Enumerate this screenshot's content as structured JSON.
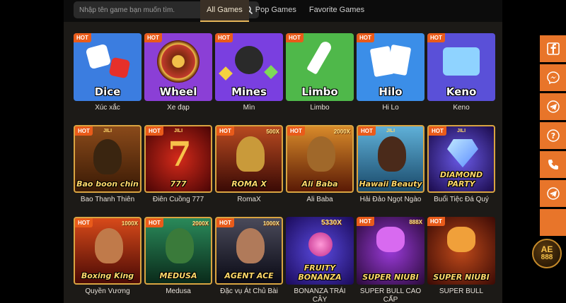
{
  "search": {
    "placeholder": "Nhập tên game bạn muốn tìm."
  },
  "tabs": [
    {
      "label": "All Games",
      "active": true
    },
    {
      "label": "Pop Games",
      "active": false
    },
    {
      "label": "Favorite Games",
      "active": false
    }
  ],
  "hot_badge": "HOT",
  "brand_label": "JILI",
  "games": [
    {
      "name": "Xúc xắc",
      "tile_label": "Dice",
      "bg": "#3b7de0"
    },
    {
      "name": "Xe đạp",
      "tile_label": "Wheel",
      "bg": "#8b3fd6"
    },
    {
      "name": "Mìn",
      "tile_label": "Mines",
      "bg": "#7a3fe0"
    },
    {
      "name": "Limbo",
      "tile_label": "Limbo",
      "bg": "#4fb84a"
    },
    {
      "name": "Hi Lo",
      "tile_label": "Hilo",
      "bg": "#3b8ee8"
    },
    {
      "name": "Keno",
      "tile_label": "Keno",
      "bg": "#5a50d8"
    },
    {
      "name": "Bao Thanh Thiên",
      "tile_label": "Bao boon chin",
      "bg": "#5a2a10"
    },
    {
      "name": "Điên Cuồng 777",
      "tile_label": "777",
      "bg": "#a01a10"
    },
    {
      "name": "RomaX",
      "tile_label": "ROMA X",
      "bg": "#7a1a10",
      "mult": "500X"
    },
    {
      "name": "Ali Baba",
      "tile_label": "Ali Baba",
      "bg": "#8a4a10",
      "mult": "2000X"
    },
    {
      "name": "Hải Đảo Ngọt Ngào",
      "tile_label": "Hawaii Beauty",
      "bg": "#2a6a80"
    },
    {
      "name": "Buổi Tiệc Đá Quý",
      "tile_label": "DIAMOND PARTY",
      "bg": "#3a2a8a"
    },
    {
      "name": "Quyền Vương",
      "tile_label": "Boxing King",
      "bg": "#8a2010",
      "mult": "1000X"
    },
    {
      "name": "Medusa",
      "tile_label": "MEDUSA",
      "bg": "#1a5a3a",
      "mult": "2000X"
    },
    {
      "name": "Đặc vụ Át Chủ Bài",
      "tile_label": "AGENT ACE",
      "bg": "#2a2a3a",
      "mult": "1000X"
    },
    {
      "name": "BONANZA TRÁI CÂY",
      "tile_label": "FRUITY BONANZA",
      "bg": "#3a2a8a",
      "mult": "5330X"
    },
    {
      "name": "SUPER BULL CAO CẤP",
      "tile_label": "SUPER NIUBI",
      "bg": "#5a1a6a",
      "mult": "888X"
    },
    {
      "name": "SUPER BULL",
      "tile_label": "SUPER NIUBI",
      "bg": "#6a1a10"
    }
  ],
  "social": [
    {
      "icon": "facebook-icon"
    },
    {
      "icon": "messenger-icon"
    },
    {
      "icon": "telegram-icon"
    },
    {
      "icon": "help-icon"
    },
    {
      "icon": "phone-icon"
    },
    {
      "icon": "telegram-icon"
    },
    {
      "icon": "blank"
    }
  ],
  "chat_badge": {
    "line1": "AE",
    "line2": "888"
  },
  "colors": {
    "accent": "#e8752a",
    "hot_badge": "#e95b1a",
    "tab_active_border": "#e6b65a",
    "panel_bg": "#1c1a17"
  }
}
